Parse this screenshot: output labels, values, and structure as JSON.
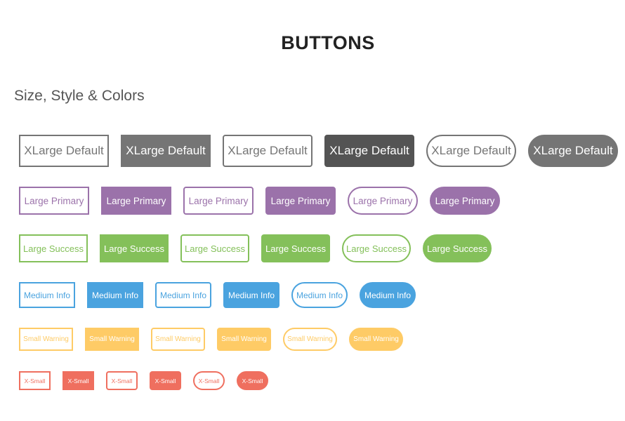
{
  "header": {
    "title": "BUTTONS",
    "subtitle": "Size, Style & Colors"
  },
  "colors": {
    "default": "#757575",
    "default_dark": "#545454",
    "primary": "#9b72aa",
    "success": "#84c05a",
    "info": "#4aa3df",
    "warning": "#fecb66",
    "danger": "#ef6f5f"
  },
  "rows": [
    {
      "label": "XLarge Default",
      "size": "xl",
      "color": "default"
    },
    {
      "label": "Large Primary",
      "size": "lg",
      "color": "primary"
    },
    {
      "label": "Large Success",
      "size": "lgs",
      "color": "success"
    },
    {
      "label": "Medium Info",
      "size": "md",
      "color": "info"
    },
    {
      "label": "Small Warning",
      "size": "sm",
      "color": "warning"
    },
    {
      "label": "X-Small",
      "size": "xs",
      "color": "danger"
    }
  ],
  "styles": [
    "square-outline",
    "square-filled",
    "rounded-outline",
    "rounded-filled",
    "pill-outline",
    "pill-filled"
  ]
}
